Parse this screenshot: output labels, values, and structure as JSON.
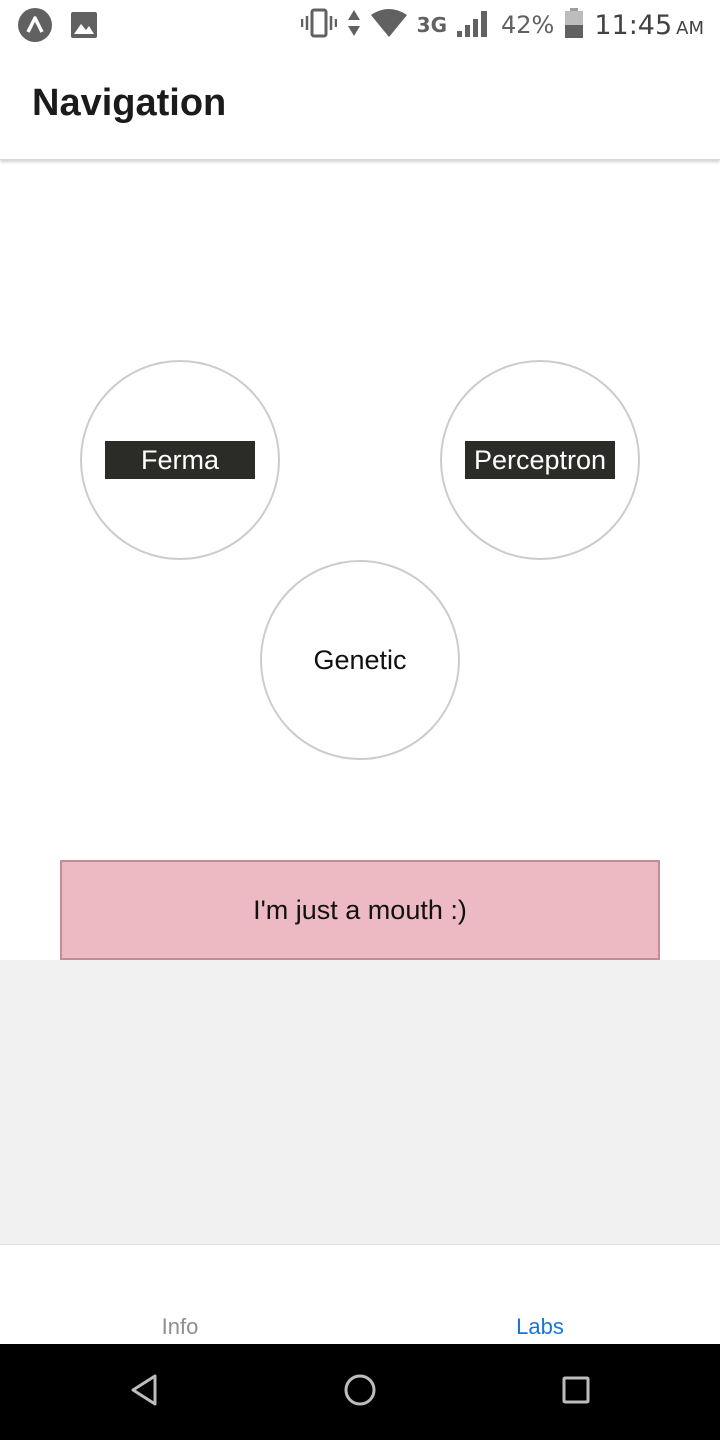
{
  "status_bar": {
    "network": "3G",
    "battery": "42%",
    "time": "11:45",
    "ampm": "AM",
    "icons": [
      "app-icon",
      "image-icon",
      "vibrate-icon",
      "data-arrows-icon",
      "wifi-icon",
      "signal-icon",
      "battery-icon"
    ]
  },
  "header": {
    "title": "Navigation"
  },
  "labs": {
    "ferma": "Ferma",
    "perceptron": "Perceptron",
    "genetic": "Genetic"
  },
  "mouth": {
    "text": "I'm just a mouth :)"
  },
  "tabs": [
    {
      "label": "Info",
      "active": false
    },
    {
      "label": "Labs",
      "active": true
    }
  ],
  "colors": {
    "active_tab": "#1976d2",
    "inactive_tab": "#8e8e93",
    "mouth_bg": "#edbac3",
    "label_bg": "#2b2b28"
  },
  "nav_bar": {
    "icons": [
      "back-icon",
      "home-icon",
      "recents-icon"
    ]
  }
}
